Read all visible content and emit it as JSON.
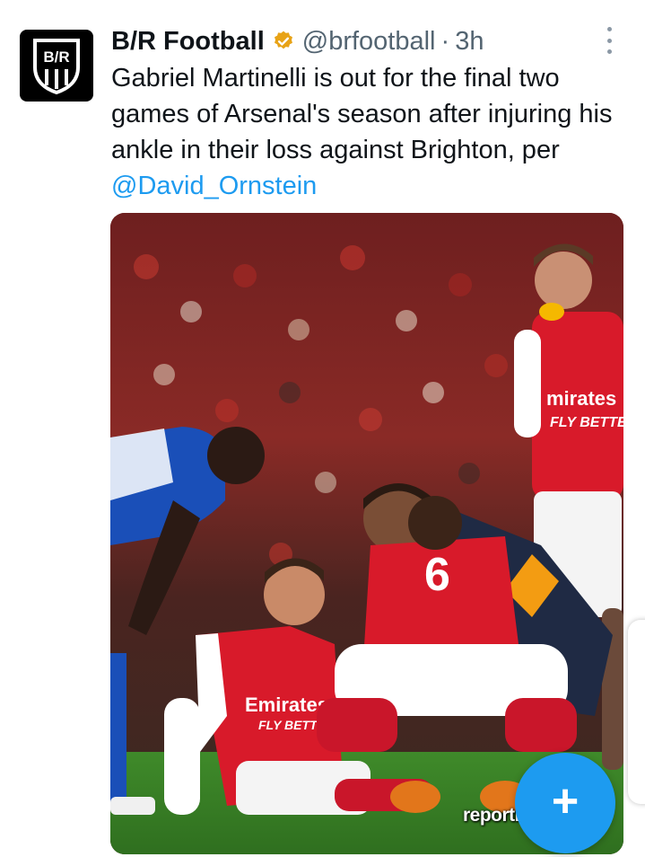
{
  "tweet": {
    "author_name": "B/R Football",
    "handle": "@brfootball",
    "separator": "·",
    "time": "3h",
    "text_main": "Gabriel Martinelli is out for the final two games of Arsenal's season after injuring his ankle in their loss against Brighton, per ",
    "mention": "@David_Ornstein",
    "avatar_text": "B/R",
    "media": {
      "watermark": "reportminds.com",
      "shirt_number": "6",
      "sponsor_text": "Emirates",
      "sponsor_subtext": "FLY BETTER"
    }
  },
  "fab": {
    "icon": "plus-icon",
    "label": "+"
  },
  "colors": {
    "accent": "#1d9bf0",
    "verified": "#e8a317",
    "text_primary": "#0f1419",
    "text_secondary": "#536471",
    "arsenal_red": "#d81a2a"
  }
}
